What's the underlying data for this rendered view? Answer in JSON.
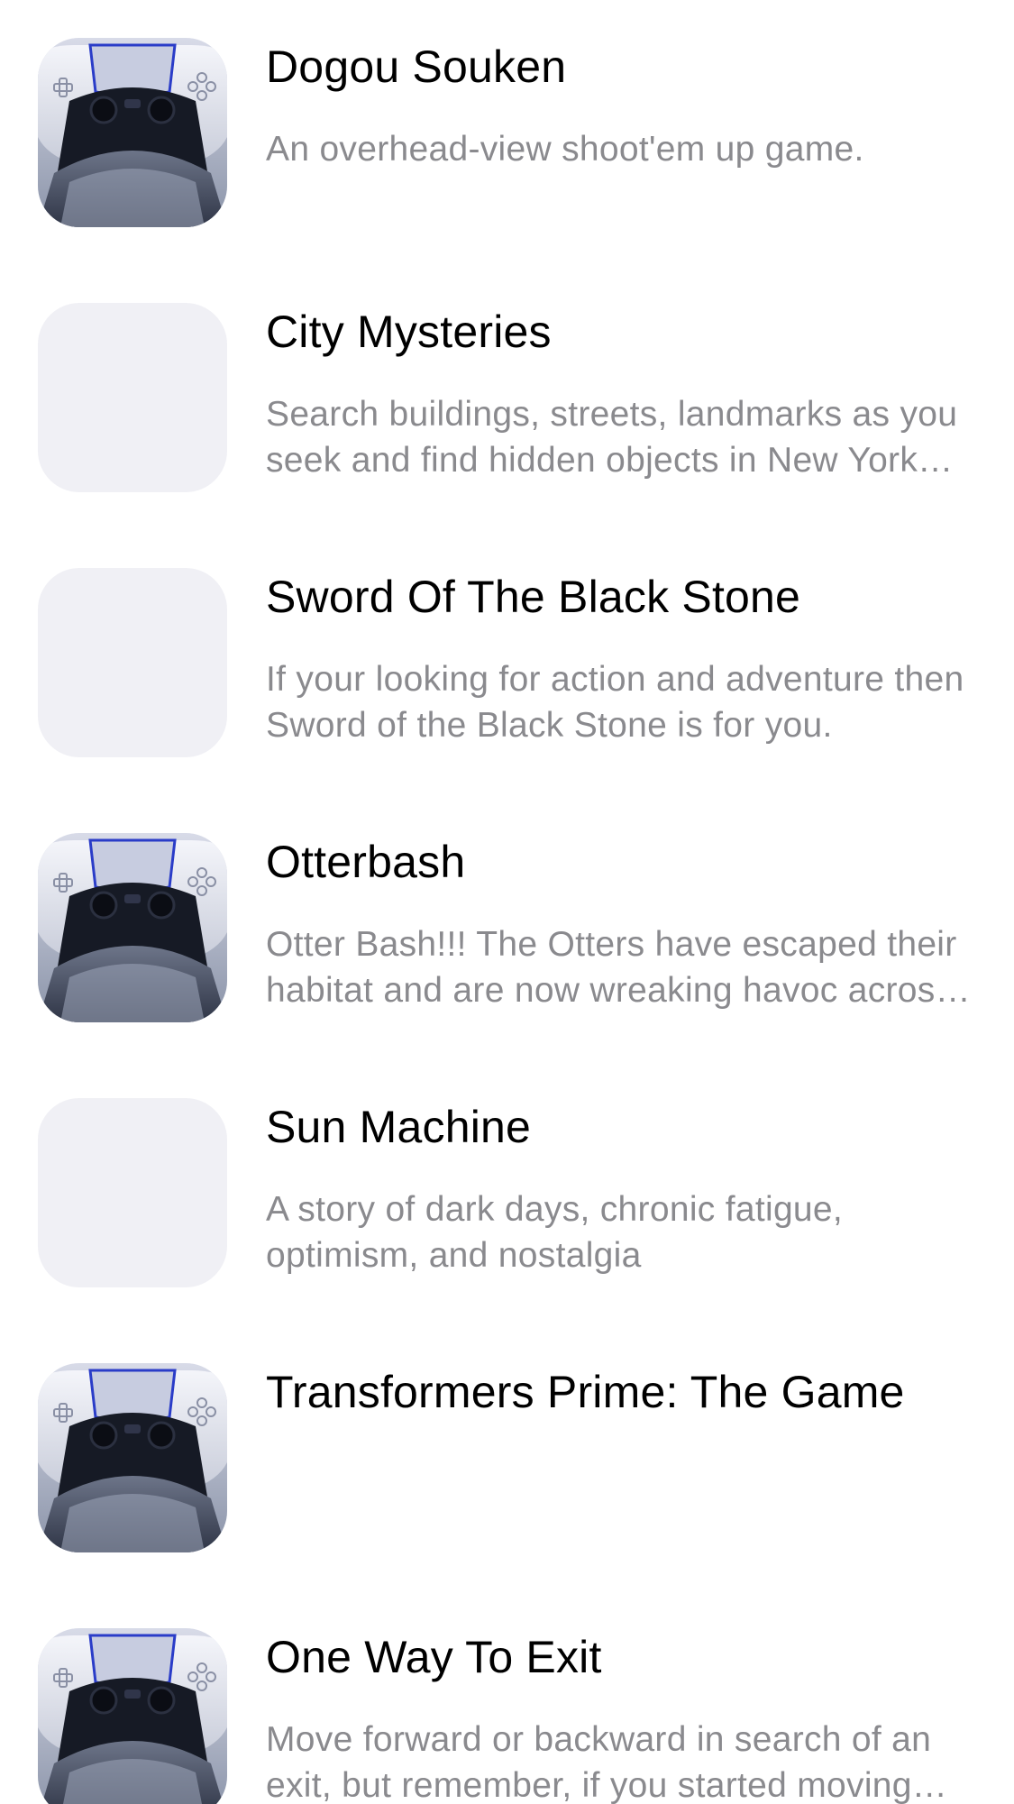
{
  "games": [
    {
      "title": "Dogou Souken",
      "description": "An overhead-view shoot'em up game.",
      "icon": "game-controller-icon"
    },
    {
      "title": "City Mysteries",
      "description": "Search buildings, streets, landmarks as you seek and find hidden objects in New York City.",
      "icon": "placeholder-icon"
    },
    {
      "title": "Sword Of The Black Stone",
      "description": "If your looking for action and adventure then Sword of the Black Stone is for you.",
      "icon": "placeholder-icon"
    },
    {
      "title": "Otterbash",
      "description": "Otter Bash!!! The Otters have escaped their habitat and are now wreaking havoc across the city.",
      "icon": "game-controller-icon"
    },
    {
      "title": "Sun Machine",
      "description": "A story of dark days, chronic fatigue, optimism, and nostalgia",
      "icon": "placeholder-icon"
    },
    {
      "title": "Transformers Prime: The Game",
      "description": "",
      "icon": "game-controller-icon"
    },
    {
      "title": "One Way To Exit",
      "description": "Move forward or backward in search of an exit, but remember, if you started moving one way you can't turn back.",
      "icon": "game-controller-icon"
    }
  ]
}
